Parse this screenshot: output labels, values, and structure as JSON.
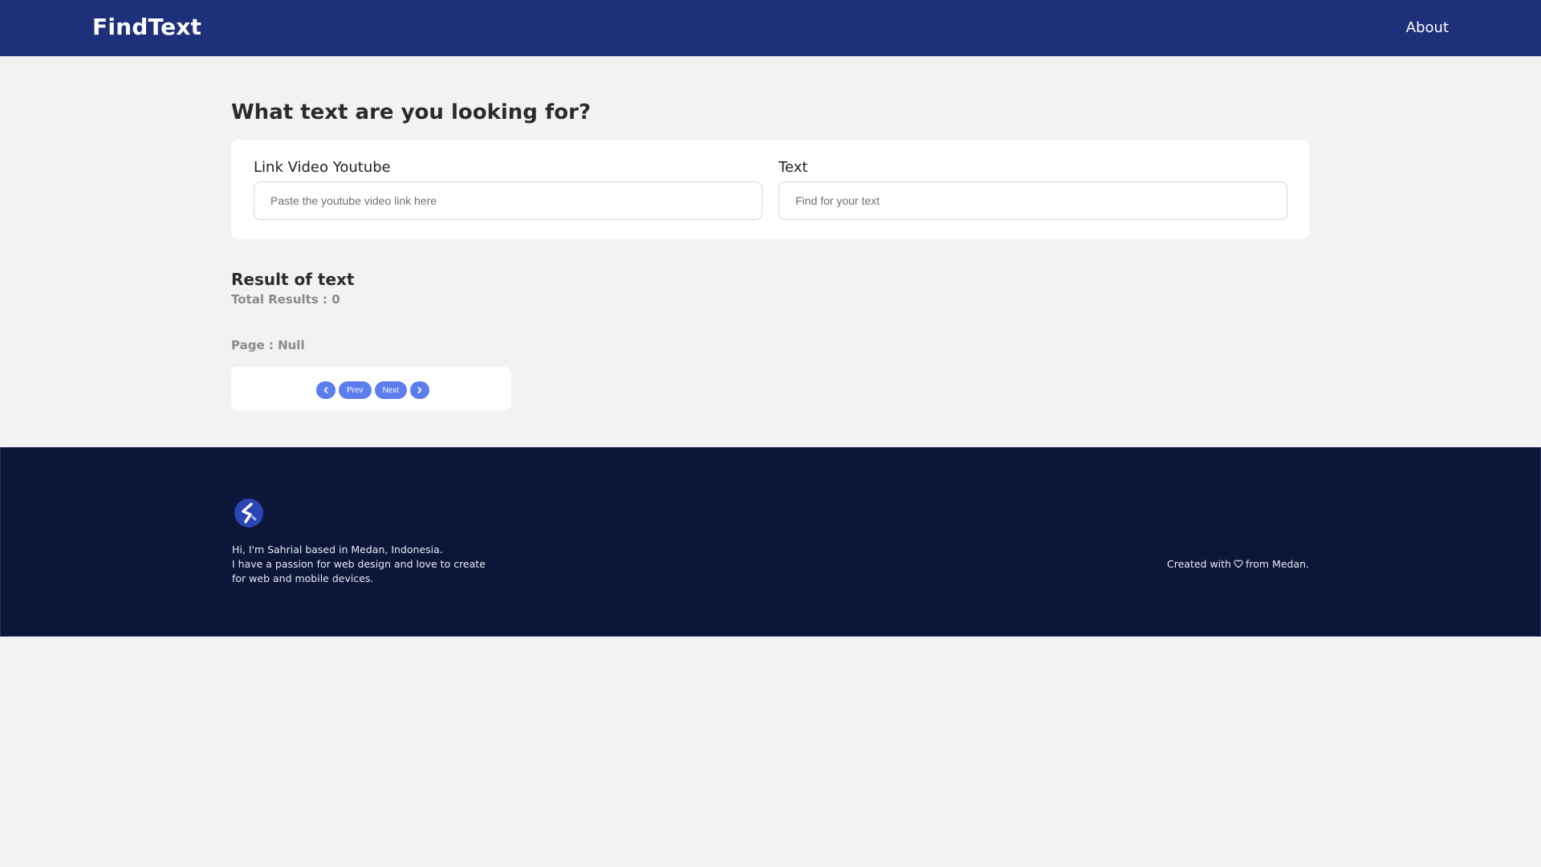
{
  "navbar": {
    "brand": "FindText",
    "links": [
      {
        "label": "About"
      }
    ],
    "background": "#1e307a"
  },
  "search": {
    "heading": "What text are you looking for?",
    "video_link": {
      "label": "Link Video Youtube",
      "placeholder": "Paste the youtube video link here",
      "value": ""
    },
    "text": {
      "label": "Text",
      "placeholder": "Find for your text",
      "value": ""
    }
  },
  "results": {
    "title": "Result of text",
    "total": "Total Results : 0",
    "page": "Page : Null"
  },
  "pagination": {
    "first_icon": "chevron-left-icon",
    "prev_label": "Prev",
    "next_label": "Next",
    "last_icon": "chevron-right-icon",
    "accent": "#5b7df0"
  },
  "footer": {
    "logo_icon": "s-logo-icon",
    "about_lines": [
      "Hi, I'm Sahrial based in Medan, Indonesia.",
      "I have a passion for web design and love to create",
      "for web and mobile devices."
    ],
    "credit_prefix": "Created with",
    "credit_icon": "heart-icon",
    "credit_suffix": "from Medan.",
    "background": "#0c1639"
  }
}
